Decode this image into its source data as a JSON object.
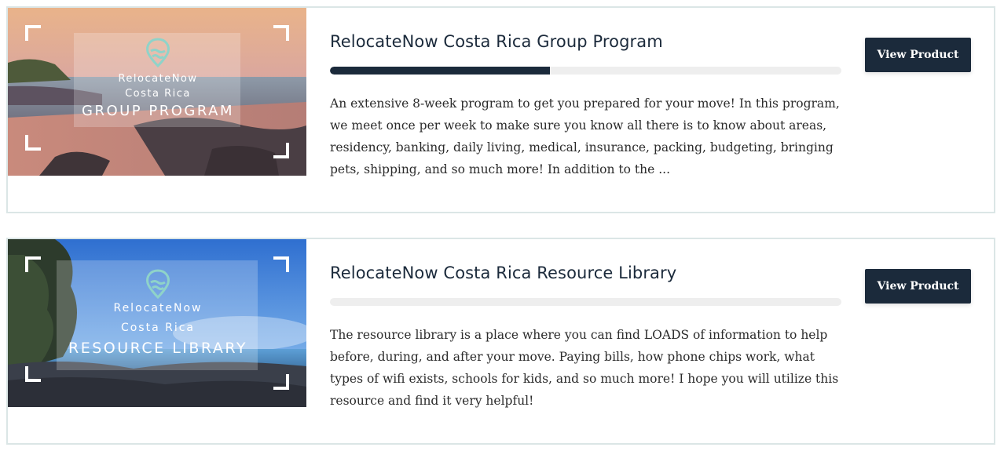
{
  "products": [
    {
      "title": "RelocateNow Costa Rica Group Program",
      "progress": 0.43,
      "description": "An extensive 8-week program to get you prepared for your move! In this program, we meet once per week to make sure you know all there is to know about areas, residency, banking, daily living, medical, insurance, packing, budgeting, bringing pets, shipping, and so much more! In addition to the ...",
      "button_label": "View Product",
      "image": {
        "brand": "RelocateNow",
        "subtitle": "Costa Rica",
        "label": "GROUP PROGRAM",
        "scene": "beach-sunset",
        "logo_icon": "location-pin-wave-icon"
      }
    },
    {
      "title": "RelocateNow Costa Rica Resource Library",
      "progress": 0,
      "description": "The resource library is a place where you can find LOADS of information to help before, during, and after your move. Paying bills, how phone chips work, what types of wifi exists, schools for kids, and so much more! I hope you will utilize this resource and find it very helpful!",
      "button_label": "View Product",
      "image": {
        "brand": "RelocateNow",
        "subtitle": "Costa Rica",
        "label": "RESOURCE LIBRARY",
        "scene": "rocky-shore-blue-sky",
        "logo_icon": "location-pin-wave-icon"
      }
    }
  ],
  "colors": {
    "navy": "#1b2a3b",
    "teal_logo": "#8fd3c9",
    "card_border": "#dbe6e6",
    "progress_track": "#eeeeee"
  }
}
